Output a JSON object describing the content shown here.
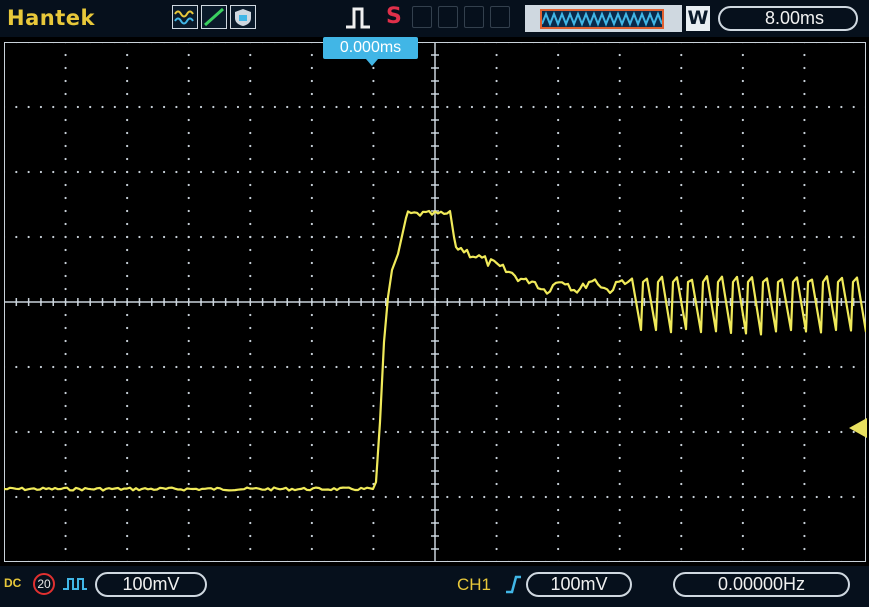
{
  "header": {
    "brand": "Hantek",
    "run_state": "S",
    "timebase": "8.00ms",
    "window_badge": "W"
  },
  "trigger_position": "0.000ms",
  "footer": {
    "coupling": "DC",
    "bw_limit": "20",
    "ch1_scale": "100mV",
    "trigger_channel": "CH1",
    "trigger_level": "100mV",
    "frequency": "0.00000Hz"
  },
  "colors": {
    "trace": "#f0ea5a",
    "grid": "#c9d2da",
    "accent": "#41b6e6",
    "brand": "#e8c83a"
  },
  "icons": {
    "mode_1": "waveform-icon",
    "mode_2": "slope-icon",
    "mode_3": "shield-icon",
    "trigger_edge": "rising-edge-icon",
    "trigger_slope": "rising-slope-icon",
    "channel_wave": "square-wave-icon"
  }
}
